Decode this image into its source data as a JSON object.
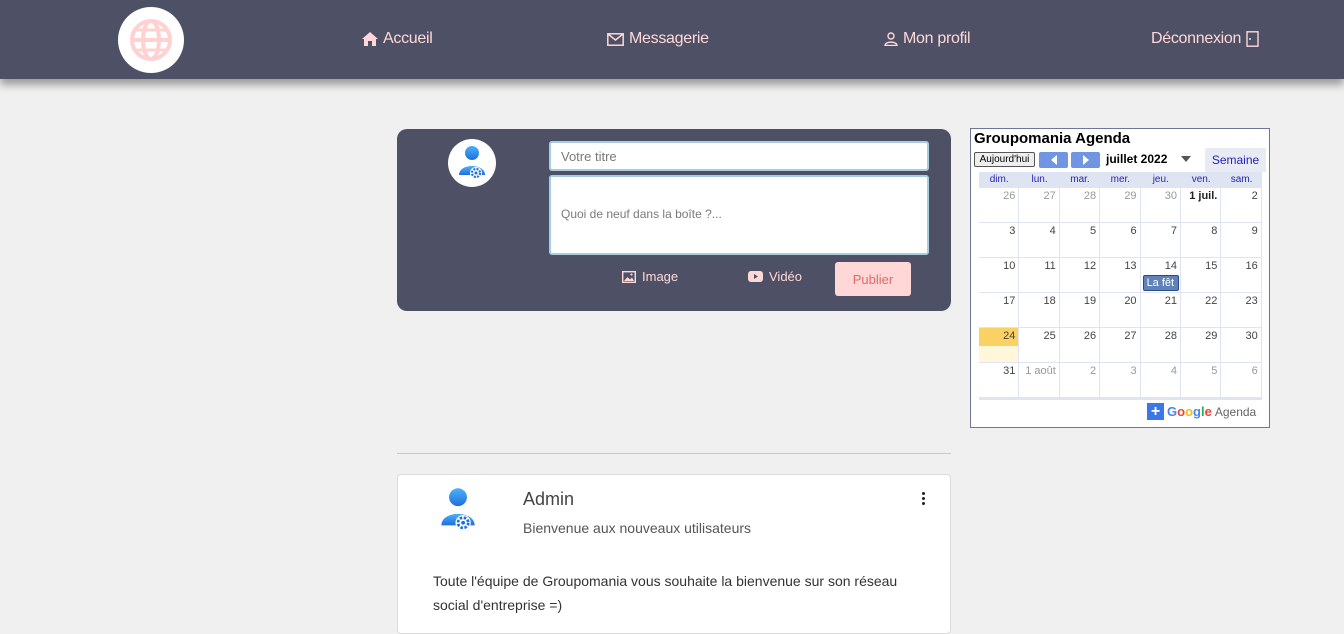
{
  "nav": {
    "home": "Accueil",
    "messages": "Messagerie",
    "profile": "Mon profil",
    "logout": "Déconnexion"
  },
  "composer": {
    "title_placeholder": "Votre titre",
    "body_placeholder": "Quoi de neuf dans la boîte ?...",
    "image_label": "Image",
    "video_label": "Vidéo",
    "publish_label": "Publier"
  },
  "post": {
    "author": "Admin",
    "title": "Bienvenue aux nouveaux utilisateurs",
    "body": "Toute l'équipe de Groupomania vous souhaite la bienvenue sur son réseau social d'entreprise =)"
  },
  "calendar": {
    "title": "Groupomania Agenda",
    "today_label": "Aujourd'hui",
    "month": "juillet 2022",
    "view_tab": "Semaine",
    "weekdays": [
      "dim.",
      "lun.",
      "mar.",
      "mer.",
      "jeu.",
      "ven.",
      "sam."
    ],
    "weeks": [
      [
        "26",
        "27",
        "28",
        "29",
        "30",
        "1 juil.",
        "2"
      ],
      [
        "3",
        "4",
        "5",
        "6",
        "7",
        "8",
        "9"
      ],
      [
        "10",
        "11",
        "12",
        "13",
        "14",
        "15",
        "16"
      ],
      [
        "17",
        "18",
        "19",
        "20",
        "21",
        "22",
        "23"
      ],
      [
        "24",
        "25",
        "26",
        "27",
        "28",
        "29",
        "30"
      ],
      [
        "31",
        "1 août",
        "2",
        "3",
        "4",
        "5",
        "6"
      ]
    ],
    "event_label": "La fêt",
    "brand_google": "Google",
    "brand_agenda": "Agenda"
  },
  "colors": {
    "navbar": "#4e5166",
    "accent_pink": "#ffd7d7",
    "today_highlight": "#fad163"
  }
}
